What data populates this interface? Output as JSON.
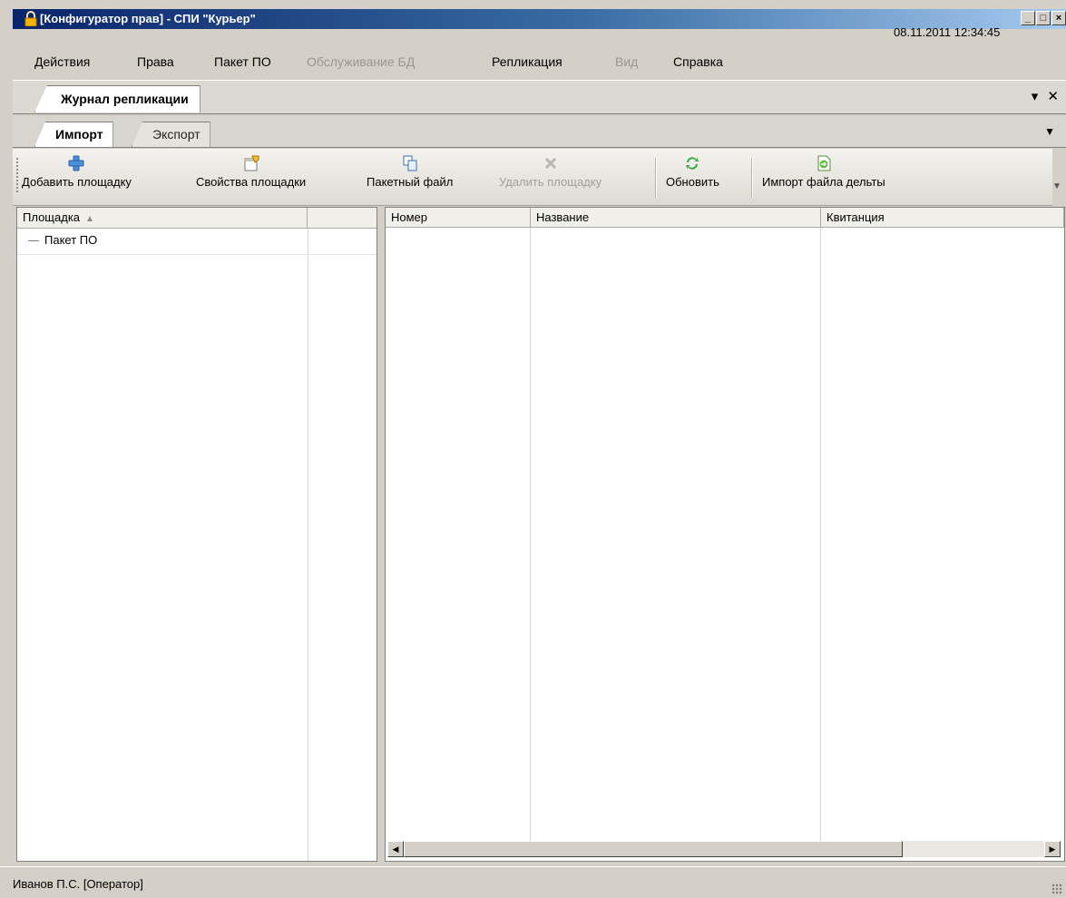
{
  "window": {
    "title": "[Конфигуратор прав] - СПИ \"Курьер\"",
    "controls": {
      "minimize": "_",
      "maximize": "□",
      "close": "×"
    }
  },
  "menubar": {
    "items": [
      {
        "label": "Действия",
        "enabled": true
      },
      {
        "label": "Права",
        "enabled": true
      },
      {
        "label": "Пакет ПО",
        "enabled": true
      },
      {
        "label": "Обслуживание БД",
        "enabled": false
      },
      {
        "label": "Репликация",
        "enabled": true
      },
      {
        "label": "Вид",
        "enabled": false
      },
      {
        "label": "Справка",
        "enabled": true
      }
    ],
    "datetime": "08.11.2011 12:34:45"
  },
  "document_tab": {
    "label": "Журнал репликации",
    "dropdown": "▾",
    "close": "✕"
  },
  "sub_tabs": [
    {
      "label": "Импорт",
      "active": true
    },
    {
      "label": "Экспорт",
      "active": false
    }
  ],
  "toolbar": {
    "buttons": [
      {
        "label": "Добавить площадку",
        "icon": "plus-icon",
        "enabled": true
      },
      {
        "label": "Свойства площадки",
        "icon": "properties-icon",
        "enabled": true
      },
      {
        "label": "Пакетный файл",
        "icon": "batch-file-icon",
        "enabled": true
      },
      {
        "label": "Удалить площадку",
        "icon": "delete-icon",
        "enabled": false
      },
      {
        "label": "Обновить",
        "icon": "refresh-icon",
        "enabled": true
      },
      {
        "label": "Импорт файла дельты",
        "icon": "import-file-icon",
        "enabled": true
      }
    ]
  },
  "left_grid": {
    "columns": [
      "Площадка"
    ],
    "rows": [
      "Пакет ПО"
    ]
  },
  "right_grid": {
    "columns": [
      "Номер",
      "Название",
      "Квитанция"
    ],
    "rows": []
  },
  "status_bar": {
    "user": "Иванов П.С. [Оператор]"
  },
  "colors": {
    "titlebar_start": "#0a246a",
    "titlebar_end": "#a6caf0",
    "disabled_text": "#9a978f"
  }
}
